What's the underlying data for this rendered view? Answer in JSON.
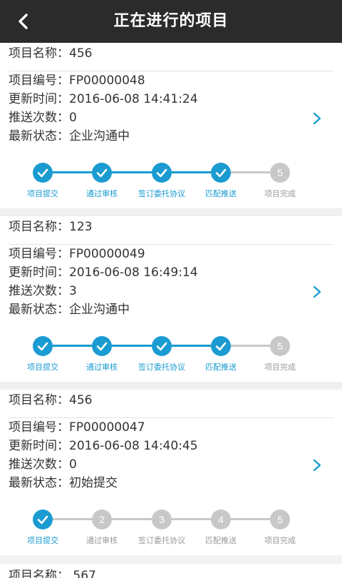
{
  "header": {
    "title": "正在进行的项目",
    "back_icon": "back-chevron-icon"
  },
  "colors": {
    "header_bg": "#2b2b2b",
    "accent": "#1a9bd1",
    "inactive": "#c8c8c8",
    "text": "#333333"
  },
  "labels": {
    "name": "项目名称：",
    "code": "项目编号：",
    "updated": "更新时间：",
    "push_count": "推送次数：",
    "status": "最新状态："
  },
  "steps": [
    "项目提交",
    "通过审核",
    "签订委托协议",
    "匹配推送",
    "项目完成"
  ],
  "projects": [
    {
      "name": "456",
      "code": "FP00000048",
      "updated": "2016-06-08 14:41:24",
      "push_count": "0",
      "status": "企业沟通中",
      "completed_steps": 4
    },
    {
      "name": "123",
      "code": "FP00000049",
      "updated": "2016-06-08 16:49:14",
      "push_count": "3",
      "status": "企业沟通中",
      "completed_steps": 4
    },
    {
      "name": "456",
      "code": "FP00000047",
      "updated": "2016-06-08 14:40:45",
      "push_count": "0",
      "status": "初始提交",
      "completed_steps": 1
    }
  ],
  "partial_project": {
    "name": "567"
  }
}
